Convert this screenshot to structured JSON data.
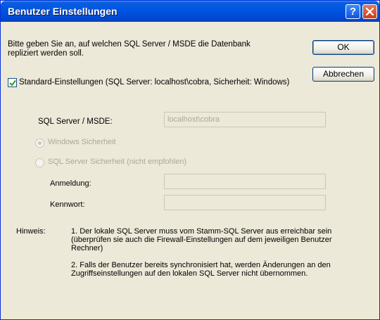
{
  "window": {
    "title": "Benutzer Einstellungen",
    "help_glyph": "?"
  },
  "intro_text": "Bitte geben Sie an, auf welchen SQL Server / MSDE die Datenbank repliziert werden soll.",
  "buttons": {
    "ok": "OK",
    "cancel": "Abbrechen"
  },
  "standard_settings": {
    "label": "Standard-Einstellungen (SQL Server: localhost\\cobra, Sicherheit: Windows)",
    "checked": true
  },
  "server": {
    "label": "SQL Server / MSDE:",
    "value": "localhost\\cobra"
  },
  "security": {
    "windows_label": "Windows Sicherheit",
    "windows_selected": true,
    "sql_label": "SQL Server Sicherheit (nicht empfohlen)",
    "sql_selected": false
  },
  "login": {
    "label": "Anmeldung:",
    "value": ""
  },
  "password": {
    "label": "Kennwort:",
    "value": ""
  },
  "hint": {
    "label": "Hinweis:",
    "note1": "1. Der lokale SQL Server muss vom Stamm-SQL Server aus erreichbar sein (überprüfen sie auch die Firewall-Einstellungen auf dem jeweiligen Benutzer Rechner)",
    "note2": "2. Falls der Benutzer bereits synchronisiert hat, werden Änderungen an den Zugriffseinstellungen auf den lokalen SQL Server nicht übernommen."
  },
  "colors": {
    "titlebar": "#0054e3",
    "dialog_bg": "#ece9d8",
    "close_button": "#d4502b",
    "checkmark": "#21a121"
  }
}
